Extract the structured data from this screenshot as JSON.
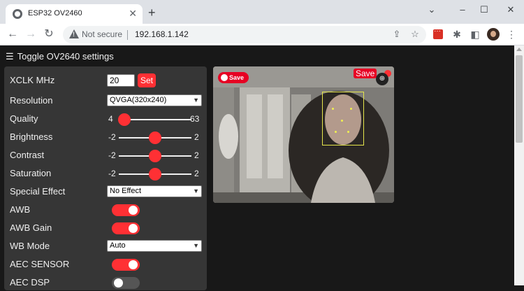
{
  "browser": {
    "tab_title": "ESP32 OV2460",
    "tab_close": "✕",
    "new_tab": "+",
    "minimize": "–",
    "maximize": "☐",
    "close": "✕",
    "back": "←",
    "forward": "→",
    "reload": "↻",
    "security_label": "Not secure",
    "url": "192.168.1.142",
    "share_icon": "⇪",
    "star_icon": "☆",
    "extensions_icon": "✱",
    "sidebar_icon": "◧",
    "menu_icon": "⋮"
  },
  "page": {
    "toggle_icon": "☰",
    "toggle_label": "Toggle OV2640 settings",
    "settings": {
      "xclk": {
        "label": "XCLK MHz",
        "value": "20",
        "button": "Set"
      },
      "resolution": {
        "label": "Resolution",
        "value": "QVGA(320x240)"
      },
      "quality": {
        "label": "Quality",
        "min": "4",
        "max": "63",
        "fraction": 0.08
      },
      "brightness": {
        "label": "Brightness",
        "min": "-2",
        "max": "2",
        "fraction": 0.5
      },
      "contrast": {
        "label": "Contrast",
        "min": "-2",
        "max": "2",
        "fraction": 0.5
      },
      "saturation": {
        "label": "Saturation",
        "min": "-2",
        "max": "2",
        "fraction": 0.5
      },
      "special_effect": {
        "label": "Special Effect",
        "value": "No Effect"
      },
      "awb": {
        "label": "AWB",
        "on": true
      },
      "awb_gain": {
        "label": "AWB Gain",
        "on": true
      },
      "wb_mode": {
        "label": "WB Mode",
        "value": "Auto"
      },
      "aec_sensor": {
        "label": "AEC SENSOR",
        "on": true
      },
      "aec_dsp": {
        "label": "AEC DSP",
        "on": false
      }
    },
    "stream": {
      "pinterest_save": "Save",
      "save_label": "Save",
      "zoom_icon": "⊕"
    }
  },
  "colors": {
    "accent": "#ff3034",
    "panel": "#363636",
    "background": "#181818"
  }
}
